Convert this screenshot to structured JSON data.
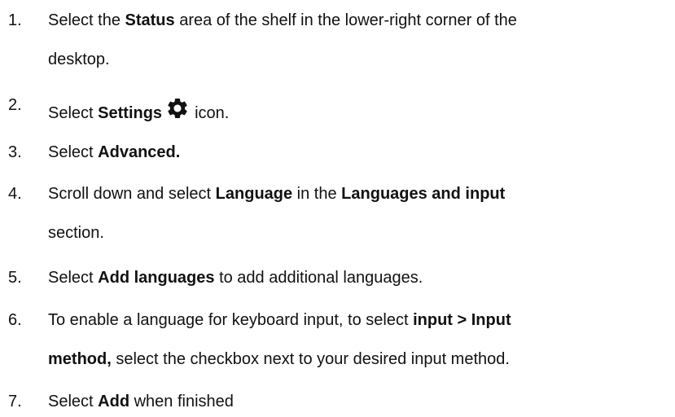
{
  "steps": [
    {
      "number": "1.",
      "line1": {
        "pre": "Select the ",
        "b": "Status",
        "post": " area of the shelf in the lower-right corner of the"
      },
      "line2": "desktop."
    },
    {
      "number": "2.",
      "pre": "Select ",
      "b": "Settings",
      "post": "icon.",
      "icon": "gear-icon"
    },
    {
      "number": "3.",
      "pre": "Select ",
      "b": "Advanced."
    },
    {
      "number": "4.",
      "line1": {
        "pre": "Scroll down and select ",
        "b1": "Language",
        "mid": " in the ",
        "b2": "Languages and input"
      },
      "line2": "section."
    },
    {
      "number": "5.",
      "pre": "Select ",
      "b": "Add languages",
      "post": " to add additional languages."
    },
    {
      "number": "6.",
      "line1": {
        "pre": "To enable a language for keyboard input, to select ",
        "b": "input > Input"
      },
      "line2": {
        "b": "method,",
        "post": " select the checkbox next to your desired input method."
      }
    },
    {
      "number": "7.",
      "pre": "Select ",
      "b": "Add",
      "post": " when finished"
    }
  ]
}
